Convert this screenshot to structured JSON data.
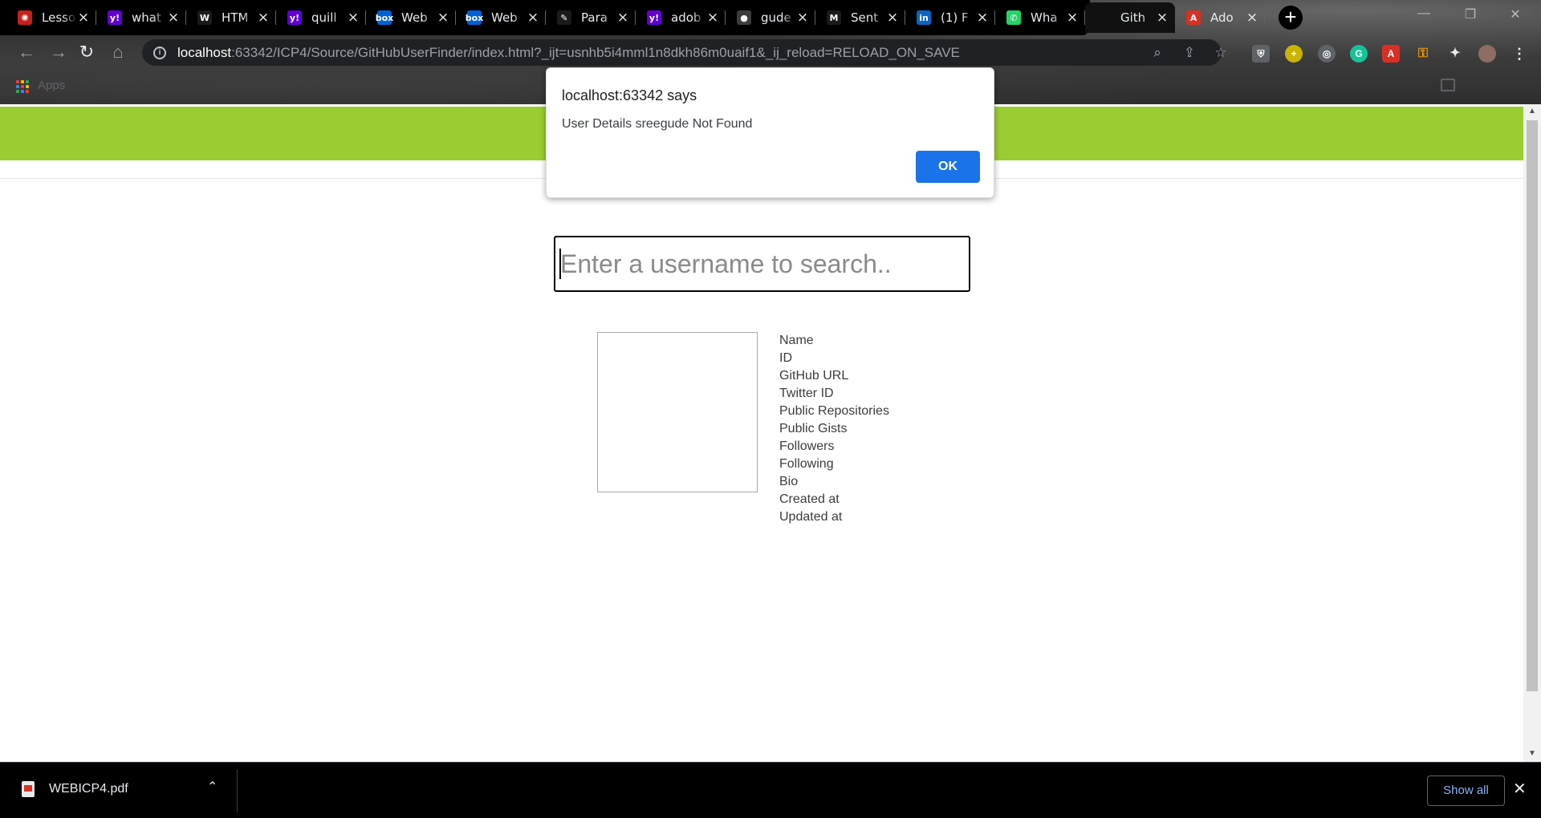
{
  "browser": {
    "tabs": [
      {
        "title": "Lesso",
        "favicon_color": "#c5221f",
        "favicon_glyph": "✺",
        "icon": "opera-icon"
      },
      {
        "title": "what",
        "favicon_color": "#6001d2",
        "favicon_glyph": "y!",
        "icon": "yahoo-icon"
      },
      {
        "title": "HTM",
        "favicon_color": "#1b1b1b",
        "favicon_glyph": "W",
        "icon": "w3-icon"
      },
      {
        "title": "quill",
        "favicon_color": "#6001d2",
        "favicon_glyph": "y!",
        "icon": "yahoo-icon"
      },
      {
        "title": "Web",
        "favicon_color": "#0061d5",
        "favicon_glyph": "box",
        "icon": "box-icon"
      },
      {
        "title": "Web",
        "favicon_color": "#0061d5",
        "favicon_glyph": "box",
        "icon": "box-icon"
      },
      {
        "title": "Para",
        "favicon_color": "#1b1b1b",
        "favicon_glyph": "✎",
        "icon": "quill-icon"
      },
      {
        "title": "adob",
        "favicon_color": "#6001d2",
        "favicon_glyph": "y!",
        "icon": "yahoo-icon"
      },
      {
        "title": "gude",
        "favicon_color": "#3c3c3c",
        "favicon_glyph": "●",
        "icon": "github-icon"
      },
      {
        "title": "Sent",
        "favicon_color": "#1b1b1b",
        "favicon_glyph": "M",
        "icon": "gmail-icon"
      },
      {
        "title": "(1) F",
        "favicon_color": "#0a66c2",
        "favicon_glyph": "in",
        "icon": "linkedin-icon"
      },
      {
        "title": "Wha",
        "favicon_color": "#25d366",
        "favicon_glyph": "✆",
        "icon": "whatsapp-icon"
      },
      {
        "title": "Gith",
        "favicon_color": "transparent",
        "favicon_glyph": "",
        "icon": "github-icon",
        "active": true
      },
      {
        "title": "Ado",
        "favicon_color": "#d93025",
        "favicon_glyph": "A",
        "icon": "acrobat-icon"
      }
    ],
    "url_host": "localhost",
    "url_rest": ":63342/ICP4/Source/GitHubUserFinder/index.html?_ijt=usnhb5i4mml1n8dkh86m0uaif1&_ij_reload=RELOAD_ON_SAVE",
    "bookmarks_apps_label": "Apps"
  },
  "page": {
    "search_placeholder": "Enter a username to search..",
    "search_value": "",
    "detail_labels": [
      "Name",
      "ID",
      "GitHub URL",
      "Twitter ID",
      "Public Repositories",
      "Public Gists",
      "Followers",
      "Following",
      "Bio",
      "Created at",
      "Updated at"
    ],
    "header_color": "#9acd32"
  },
  "dialog": {
    "title": "localhost:63342 says",
    "message": "User Details sreegude Not Found",
    "ok_label": "OK"
  },
  "downloads": {
    "filename": "WEBICP4.pdf",
    "show_all_label": "Show all"
  }
}
